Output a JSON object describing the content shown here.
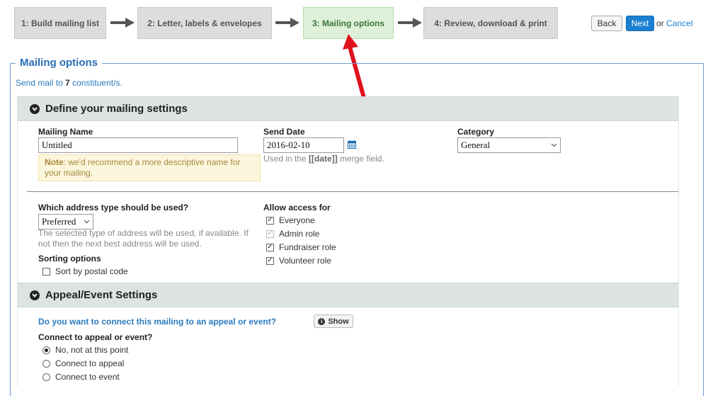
{
  "wizard": {
    "steps": [
      {
        "label": "1: Build mailing list"
      },
      {
        "label": "2: Letter, labels & envelopes"
      },
      {
        "label": "3: Mailing options"
      },
      {
        "label": "4: Review, download & print"
      }
    ],
    "back_label": "Back",
    "next_label": "Next",
    "or_label": "or",
    "cancel_label": "Cancel"
  },
  "mailing_options": {
    "legend": "Mailing options",
    "send_prefix": "Send mail to ",
    "send_count": "7",
    "send_suffix": " constituent/s."
  },
  "settings": {
    "heading": "Define your mailing settings",
    "mailing_name_label": "Mailing Name",
    "mailing_name_value": "Untitled",
    "note_prefix": "Note",
    "note_text": ": we'd recommend a more descriptive name for your mailing.",
    "send_date_label": "Send Date",
    "send_date_value": "2016-02-10",
    "send_date_help_prefix": "Used in the ",
    "send_date_help_field": "[[date]]",
    "send_date_help_suffix": " merge field.",
    "category_label": "Category",
    "category_value": "General",
    "address_type_label": "Which address type should be used?",
    "address_type_value": "Preferred",
    "address_help": "The selected type of address will be used, if available. If not then the next best address will be used.",
    "sorting_label": "Sorting options",
    "sort_postal_label": "Sort by postal code",
    "access_label": "Allow access for",
    "access_options": [
      {
        "label": "Everyone",
        "checked": true,
        "disabled": false
      },
      {
        "label": "Admin role",
        "checked": true,
        "disabled": true
      },
      {
        "label": "Fundraiser role",
        "checked": true,
        "disabled": false
      },
      {
        "label": "Volunteer role",
        "checked": true,
        "disabled": false
      }
    ]
  },
  "appeal": {
    "heading": "Appeal/Event Settings",
    "question": "Do you want to connect this mailing to an appeal or event?",
    "show_label": "Show",
    "connect_label": "Connect to appeal or event?",
    "options": [
      {
        "label": "No, not at this point",
        "selected": true
      },
      {
        "label": "Connect to appeal",
        "selected": false
      },
      {
        "label": "Connect to event",
        "selected": false
      }
    ]
  },
  "colors": {
    "active_step": "#dff0d8",
    "primary_button": "#1a7fd1",
    "legend_text": "#2a6db7",
    "annotation_arrow": "#e0121e"
  },
  "icons": {
    "calendar": "calendar-icon",
    "chevron": "chevron-circle-down-icon",
    "info": "info-circle-icon"
  }
}
